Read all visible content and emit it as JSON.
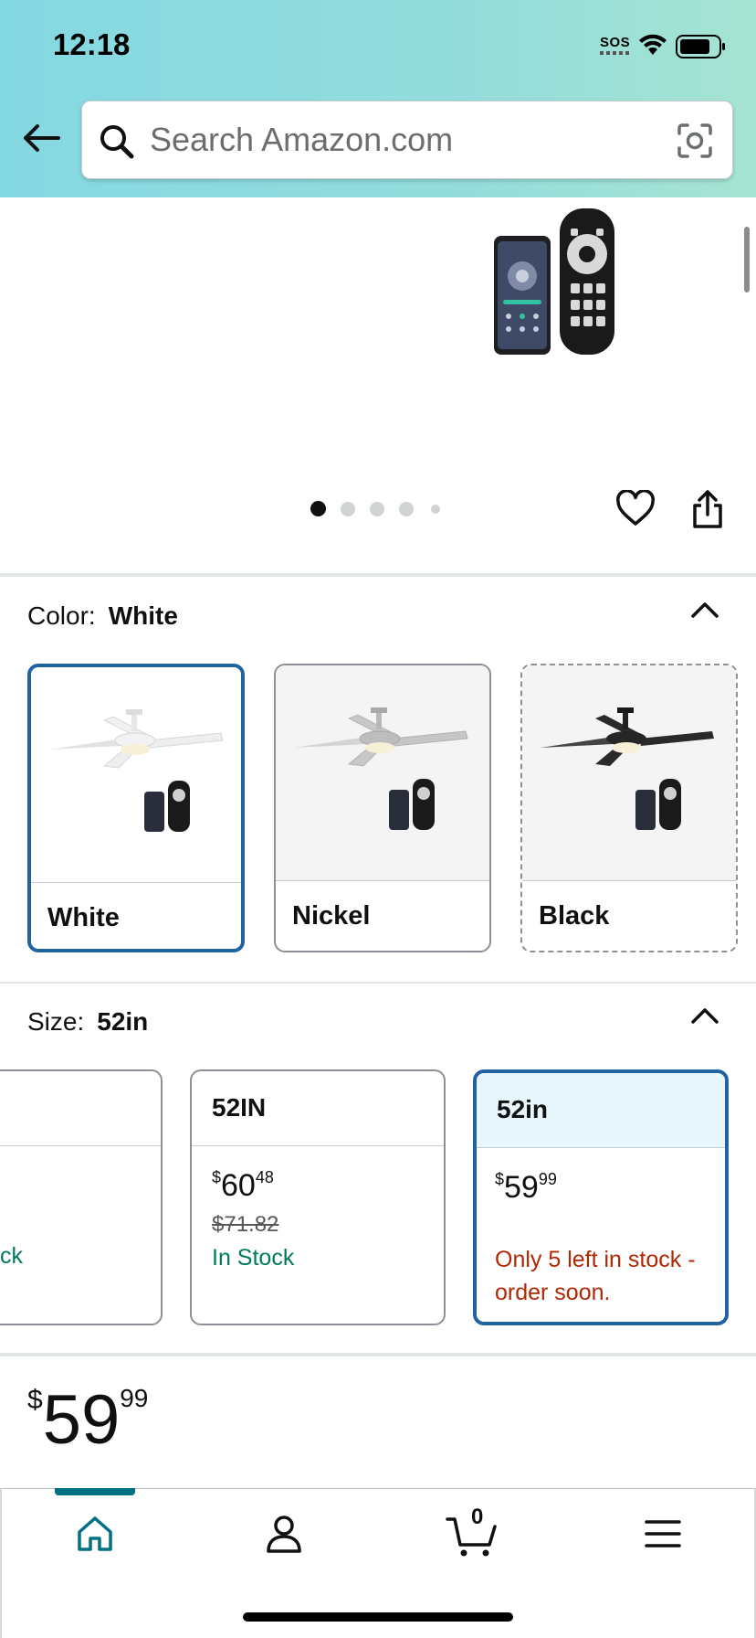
{
  "status_bar": {
    "time": "12:18",
    "sos": "SOS"
  },
  "search": {
    "placeholder": "Search Amazon.com"
  },
  "gallery": {
    "image_count": 5,
    "active_index": 0
  },
  "color_section": {
    "label": "Color:",
    "selected": "White",
    "options": [
      {
        "label": "White",
        "state": "selected"
      },
      {
        "label": "Nickel",
        "state": "available"
      },
      {
        "label": "Black",
        "state": "unavailable"
      }
    ]
  },
  "size_section": {
    "label": "Size:",
    "selected": "52in",
    "options": [
      {
        "name": "",
        "stock": "ck"
      },
      {
        "name": "52IN",
        "price_whole": "60",
        "price_cents": "48",
        "list_price": "$71.82",
        "stock": "In Stock"
      },
      {
        "name": "52in",
        "price_whole": "59",
        "price_cents": "99",
        "stock": "Only 5 left in stock - order soon."
      }
    ]
  },
  "price": {
    "currency": "$",
    "whole": "59",
    "cents": "99"
  },
  "bottom_nav": {
    "items": [
      {
        "icon": "home-icon",
        "active": true
      },
      {
        "icon": "account-icon",
        "active": false
      },
      {
        "icon": "cart-icon",
        "active": false
      },
      {
        "icon": "menu-icon",
        "active": false
      }
    ],
    "cart_count": "0"
  },
  "colors": {
    "accent": "#007185",
    "selected_border": "#2162a1",
    "in_stock": "#007a5e",
    "low_stock": "#b12704"
  }
}
